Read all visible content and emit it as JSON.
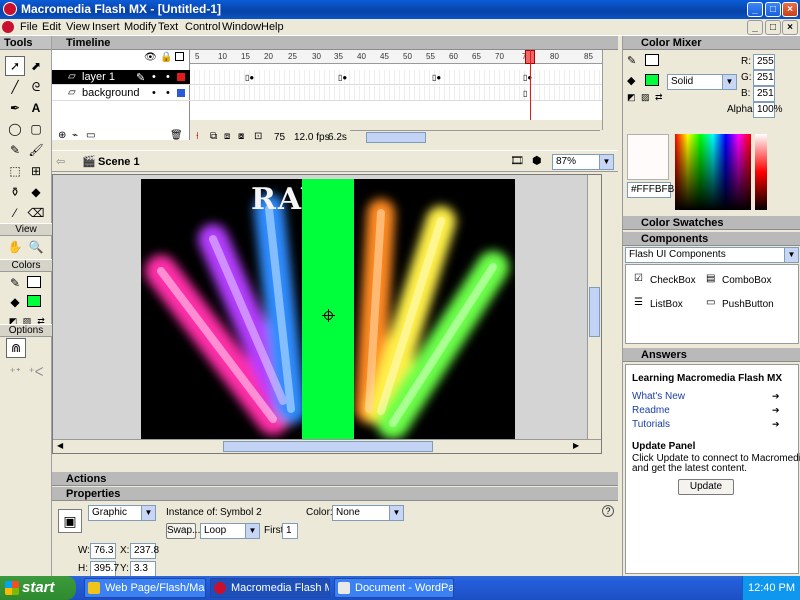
{
  "window": {
    "title": "Macromedia Flash MX - [Untitled-1]",
    "minimize": "_",
    "maximize": "□",
    "close": "×"
  },
  "menu": [
    "File",
    "Edit",
    "View",
    "Insert",
    "Modify",
    "Text",
    "Control",
    "Window",
    "Help"
  ],
  "tools": {
    "title": "Tools",
    "sections": {
      "view": "View",
      "colors": "Colors",
      "options": "Options"
    }
  },
  "timeline": {
    "title": "Timeline",
    "frame_numbers": [
      "5",
      "10",
      "15",
      "20",
      "25",
      "30",
      "35",
      "40",
      "45",
      "50",
      "55",
      "60",
      "65",
      "70",
      "75",
      "80",
      "85"
    ],
    "layers": [
      {
        "name": "layer 1",
        "active": true,
        "color": "#e21a1a"
      },
      {
        "name": "background",
        "active": false,
        "color": "#2a5ad8"
      }
    ],
    "current_frame": "75",
    "fps": "12.0 fps",
    "time": "6.2s"
  },
  "editbar": {
    "scene": "Scene 1",
    "zoom": "87%"
  },
  "stage": {
    "headline": "RAVE",
    "bar_color": "#00ff3b"
  },
  "actions": {
    "title": "Actions"
  },
  "properties": {
    "title": "Properties",
    "behavior": "Graphic",
    "instance_label": "Instance of:",
    "instance_value": "Symbol 2",
    "swap": "Swap...",
    "loop": "Loop",
    "first_label": "First:",
    "first_value": "1",
    "color_label": "Color:",
    "color_value": "None",
    "w_label": "W:",
    "w_value": "76.3",
    "h_label": "H:",
    "h_value": "395.7",
    "x_label": "X:",
    "x_value": "237.8",
    "y_label": "Y:",
    "y_value": "3.3"
  },
  "color_mixer": {
    "title": "Color Mixer",
    "r_label": "R:",
    "r": "255",
    "g_label": "G:",
    "g": "251",
    "b_label": "B:",
    "b": "251",
    "alpha_label": "Alpha:",
    "alpha": "100%",
    "fill_type": "Solid",
    "hex": "#FFFBFB",
    "fill_color": "#00ff3b"
  },
  "swatches": {
    "title": "Color Swatches"
  },
  "components": {
    "title": "Components",
    "set": "Flash UI Components",
    "items": [
      "CheckBox",
      "ComboBox",
      "ListBox",
      "PushButton"
    ]
  },
  "answers": {
    "title": "Answers",
    "heading": "Learning Macromedia Flash MX",
    "links": [
      "What's New",
      "Readme",
      "Tutorials"
    ],
    "update_title": "Update Panel",
    "update_text_1": "Click Update to connect to Macromedia.com",
    "update_text_2": "and get the latest content.",
    "update_button": "Update"
  },
  "taskbar": {
    "start": "start",
    "tasks": [
      {
        "label": "Web Page/Flash/Mas...",
        "color": "#f0c419"
      },
      {
        "label": "Macromedia Flash MX...",
        "color": "#c8102e"
      },
      {
        "label": "Document - WordPad",
        "color": "#e8e8e8"
      }
    ],
    "clock": "12:40 PM"
  }
}
